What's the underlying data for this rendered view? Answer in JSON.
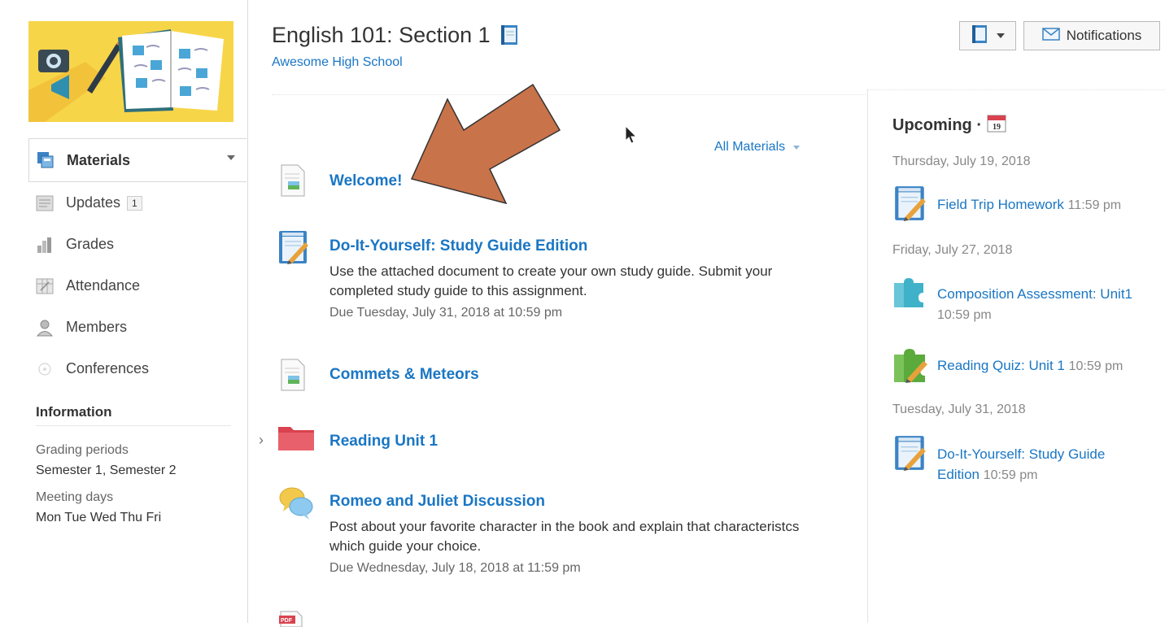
{
  "course": {
    "title": "English 101: Section 1",
    "school": "Awesome High School"
  },
  "header": {
    "notifications_label": "Notifications"
  },
  "sidebar": {
    "items": [
      {
        "label": "Materials",
        "icon": "materials-icon",
        "active": true
      },
      {
        "label": "Updates",
        "icon": "updates-icon",
        "badge": "1"
      },
      {
        "label": "Grades",
        "icon": "grades-icon"
      },
      {
        "label": "Attendance",
        "icon": "attendance-icon"
      },
      {
        "label": "Members",
        "icon": "members-icon"
      },
      {
        "label": "Conferences",
        "icon": "conferences-icon"
      }
    ],
    "information": {
      "heading": "Information",
      "grading_periods_label": "Grading periods",
      "grading_periods_value": "Semester 1, Semester 2",
      "meeting_days_label": "Meeting days",
      "meeting_days_value": "Mon Tue Wed Thu Fri"
    }
  },
  "materials": {
    "filter_label": "All Materials",
    "items": [
      {
        "title": "Welcome!",
        "icon": "page-icon"
      },
      {
        "title": "Do-It-Yourself: Study Guide Edition",
        "icon": "assignment-icon",
        "description": "Use the attached document to create your own study guide. Submit your completed study guide to this assignment.",
        "due": "Due Tuesday, July 31, 2018 at 10:59 pm"
      },
      {
        "title": "Commets & Meteors",
        "icon": "page-icon"
      },
      {
        "title": "Reading Unit 1",
        "icon": "folder-icon"
      },
      {
        "title": "Romeo and Juliet Discussion",
        "icon": "discussion-icon",
        "description": "Post about your favorite character in the book and explain that characteristcs which guide your choice.",
        "due": "Due Wednesday, July 18, 2018 at 11:59 pm"
      },
      {
        "title": "",
        "icon": "pdf-icon"
      }
    ]
  },
  "upcoming": {
    "title": "Upcoming ·",
    "calendar_day": "19",
    "groups": [
      {
        "date": "Thursday, July 19, 2018",
        "events": [
          {
            "title": "Field Trip Homework",
            "time": "11:59 pm",
            "icon": "assignment-icon"
          }
        ]
      },
      {
        "date": "Friday, July 27, 2018",
        "events": [
          {
            "title": "Composition Assessment: Unit1",
            "time": "10:59 pm",
            "icon": "assessment-puzzle-icon"
          },
          {
            "title": "Reading Quiz: Unit 1",
            "time": "10:59 pm",
            "icon": "quiz-puzzle-icon"
          }
        ]
      },
      {
        "date": "Tuesday, July 31, 2018",
        "events": [
          {
            "title": "Do-It-Yourself: Study Guide Edition",
            "time": "10:59 pm",
            "icon": "assignment-icon"
          }
        ]
      }
    ]
  },
  "colors": {
    "link": "#1a76c4",
    "cover_yellow": "#f7d549",
    "annotation_arrow": "#c9734a",
    "folder_red": "#d9424f"
  }
}
